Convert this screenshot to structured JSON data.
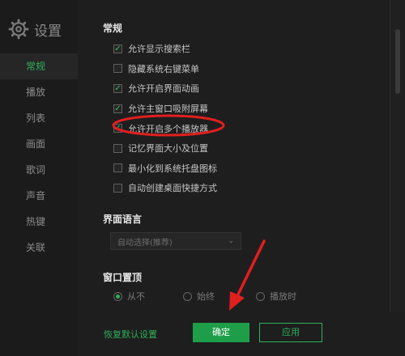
{
  "window": {
    "title": "设置",
    "top_right_text": "..."
  },
  "sidebar": {
    "items": [
      {
        "label": "常规",
        "active": true
      },
      {
        "label": "播放",
        "active": false
      },
      {
        "label": "列表",
        "active": false
      },
      {
        "label": "画面",
        "active": false
      },
      {
        "label": "歌词",
        "active": false
      },
      {
        "label": "声音",
        "active": false
      },
      {
        "label": "热键",
        "active": false
      },
      {
        "label": "关联",
        "active": false
      }
    ]
  },
  "general": {
    "title": "常规",
    "options": [
      {
        "label": "允许显示搜索栏",
        "checked": true
      },
      {
        "label": "隐藏系统右键菜单",
        "checked": false
      },
      {
        "label": "允许开启界面动画",
        "checked": true
      },
      {
        "label": "允许主窗口吸附屏幕",
        "checked": true
      },
      {
        "label": "允许开启多个播放器",
        "checked": true
      },
      {
        "label": "记忆界面大小及位置",
        "checked": false
      },
      {
        "label": "最小化到系统托盘图标",
        "checked": false
      },
      {
        "label": "自动创建桌面快捷方式",
        "checked": false
      }
    ]
  },
  "language": {
    "title": "界面语言",
    "value": "自动选择(推荐)"
  },
  "window_top": {
    "title": "窗口置顶",
    "options": [
      "从不",
      "始终",
      "播放时"
    ]
  },
  "footer": {
    "restore": "恢复默认设置",
    "ok": "确定",
    "apply": "应用"
  },
  "colors": {
    "accent": "#2fb05a",
    "highlight": "#e01f1f",
    "background": "#1e1e1e"
  },
  "icons": {
    "brand": "gear-icon",
    "check": "check-icon",
    "dropdown": "chevron-down-icon"
  }
}
